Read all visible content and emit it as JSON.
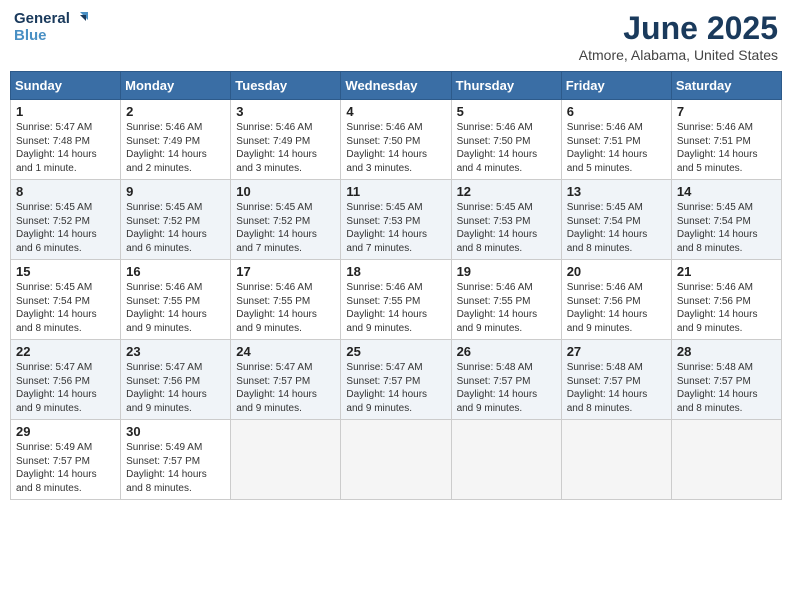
{
  "logo": {
    "line1": "General",
    "line2": "Blue"
  },
  "title": "June 2025",
  "subtitle": "Atmore, Alabama, United States",
  "days_of_week": [
    "Sunday",
    "Monday",
    "Tuesday",
    "Wednesday",
    "Thursday",
    "Friday",
    "Saturday"
  ],
  "weeks": [
    [
      {
        "day": "1",
        "sunrise": "5:47 AM",
        "sunset": "7:48 PM",
        "daylight": "14 hours and 1 minute."
      },
      {
        "day": "2",
        "sunrise": "5:46 AM",
        "sunset": "7:49 PM",
        "daylight": "14 hours and 2 minutes."
      },
      {
        "day": "3",
        "sunrise": "5:46 AM",
        "sunset": "7:49 PM",
        "daylight": "14 hours and 3 minutes."
      },
      {
        "day": "4",
        "sunrise": "5:46 AM",
        "sunset": "7:50 PM",
        "daylight": "14 hours and 3 minutes."
      },
      {
        "day": "5",
        "sunrise": "5:46 AM",
        "sunset": "7:50 PM",
        "daylight": "14 hours and 4 minutes."
      },
      {
        "day": "6",
        "sunrise": "5:46 AM",
        "sunset": "7:51 PM",
        "daylight": "14 hours and 5 minutes."
      },
      {
        "day": "7",
        "sunrise": "5:46 AM",
        "sunset": "7:51 PM",
        "daylight": "14 hours and 5 minutes."
      }
    ],
    [
      {
        "day": "8",
        "sunrise": "5:45 AM",
        "sunset": "7:52 PM",
        "daylight": "14 hours and 6 minutes."
      },
      {
        "day": "9",
        "sunrise": "5:45 AM",
        "sunset": "7:52 PM",
        "daylight": "14 hours and 6 minutes."
      },
      {
        "day": "10",
        "sunrise": "5:45 AM",
        "sunset": "7:52 PM",
        "daylight": "14 hours and 7 minutes."
      },
      {
        "day": "11",
        "sunrise": "5:45 AM",
        "sunset": "7:53 PM",
        "daylight": "14 hours and 7 minutes."
      },
      {
        "day": "12",
        "sunrise": "5:45 AM",
        "sunset": "7:53 PM",
        "daylight": "14 hours and 8 minutes."
      },
      {
        "day": "13",
        "sunrise": "5:45 AM",
        "sunset": "7:54 PM",
        "daylight": "14 hours and 8 minutes."
      },
      {
        "day": "14",
        "sunrise": "5:45 AM",
        "sunset": "7:54 PM",
        "daylight": "14 hours and 8 minutes."
      }
    ],
    [
      {
        "day": "15",
        "sunrise": "5:45 AM",
        "sunset": "7:54 PM",
        "daylight": "14 hours and 8 minutes."
      },
      {
        "day": "16",
        "sunrise": "5:46 AM",
        "sunset": "7:55 PM",
        "daylight": "14 hours and 9 minutes."
      },
      {
        "day": "17",
        "sunrise": "5:46 AM",
        "sunset": "7:55 PM",
        "daylight": "14 hours and 9 minutes."
      },
      {
        "day": "18",
        "sunrise": "5:46 AM",
        "sunset": "7:55 PM",
        "daylight": "14 hours and 9 minutes."
      },
      {
        "day": "19",
        "sunrise": "5:46 AM",
        "sunset": "7:55 PM",
        "daylight": "14 hours and 9 minutes."
      },
      {
        "day": "20",
        "sunrise": "5:46 AM",
        "sunset": "7:56 PM",
        "daylight": "14 hours and 9 minutes."
      },
      {
        "day": "21",
        "sunrise": "5:46 AM",
        "sunset": "7:56 PM",
        "daylight": "14 hours and 9 minutes."
      }
    ],
    [
      {
        "day": "22",
        "sunrise": "5:47 AM",
        "sunset": "7:56 PM",
        "daylight": "14 hours and 9 minutes."
      },
      {
        "day": "23",
        "sunrise": "5:47 AM",
        "sunset": "7:56 PM",
        "daylight": "14 hours and 9 minutes."
      },
      {
        "day": "24",
        "sunrise": "5:47 AM",
        "sunset": "7:57 PM",
        "daylight": "14 hours and 9 minutes."
      },
      {
        "day": "25",
        "sunrise": "5:47 AM",
        "sunset": "7:57 PM",
        "daylight": "14 hours and 9 minutes."
      },
      {
        "day": "26",
        "sunrise": "5:48 AM",
        "sunset": "7:57 PM",
        "daylight": "14 hours and 9 minutes."
      },
      {
        "day": "27",
        "sunrise": "5:48 AM",
        "sunset": "7:57 PM",
        "daylight": "14 hours and 8 minutes."
      },
      {
        "day": "28",
        "sunrise": "5:48 AM",
        "sunset": "7:57 PM",
        "daylight": "14 hours and 8 minutes."
      }
    ],
    [
      {
        "day": "29",
        "sunrise": "5:49 AM",
        "sunset": "7:57 PM",
        "daylight": "14 hours and 8 minutes."
      },
      {
        "day": "30",
        "sunrise": "5:49 AM",
        "sunset": "7:57 PM",
        "daylight": "14 hours and 8 minutes."
      },
      null,
      null,
      null,
      null,
      null
    ]
  ]
}
